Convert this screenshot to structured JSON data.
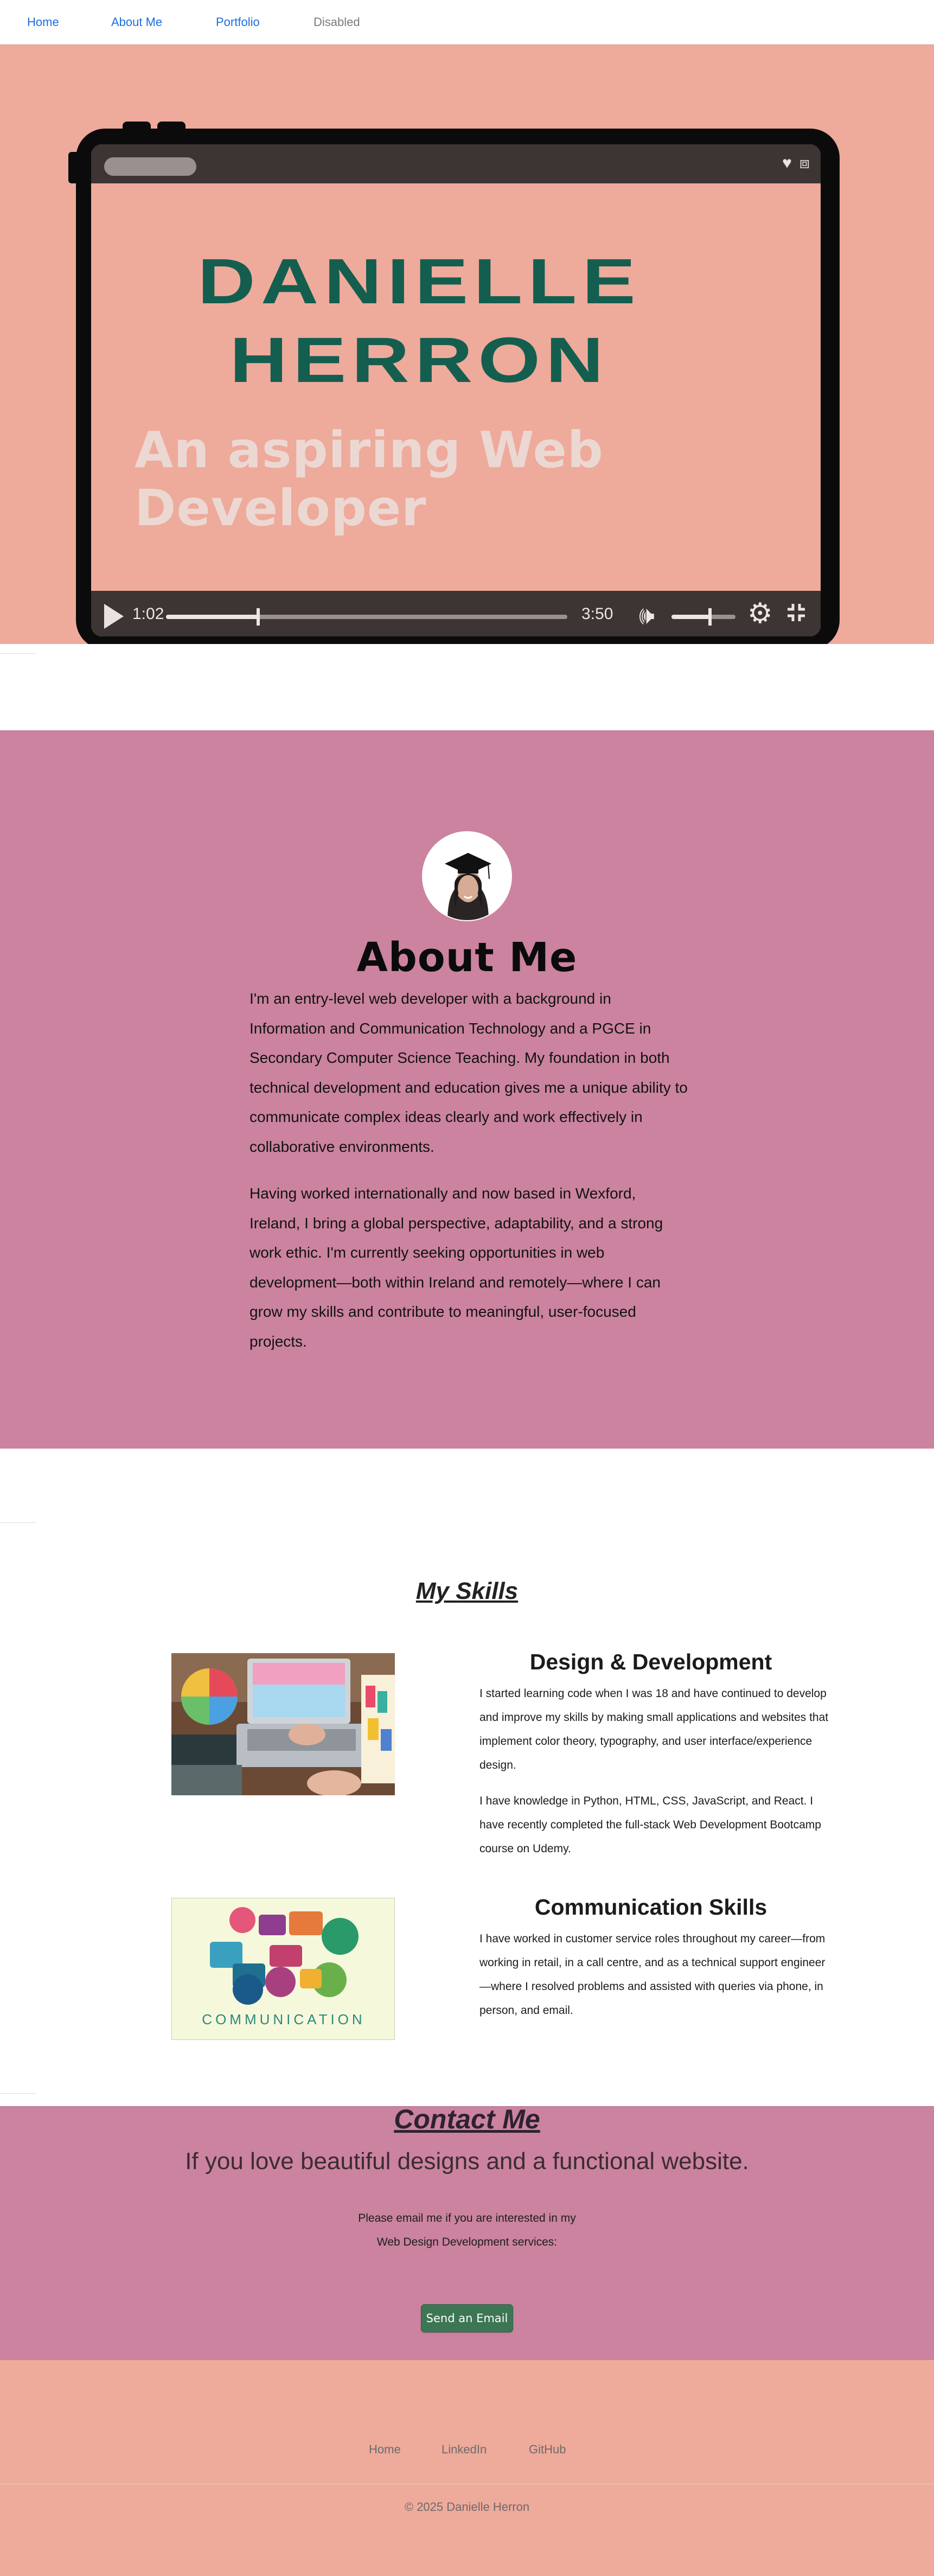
{
  "nav": {
    "items": [
      {
        "label": "Home"
      },
      {
        "label": "About Me"
      },
      {
        "label": "Portfolio"
      },
      {
        "label": "Disabled"
      }
    ]
  },
  "hero": {
    "name_line1": "DANIELLE",
    "name_line2": "HERRON",
    "tagline": "An aspiring Web Developer",
    "player": {
      "current_time": "1:02",
      "duration": "3:50",
      "progress": 0.23,
      "volume": 0.6,
      "icons": [
        "heart-icon",
        "share-icon",
        "play-icon",
        "volume-icon",
        "gear-icon",
        "fullscreen-exit-icon"
      ]
    },
    "background_color": "#eeaa9b",
    "name_color": "#145e4f"
  },
  "about": {
    "title": "About Me",
    "paragraph1": "I'm an entry-level web developer with a background in Information and Communication Technology and a PGCE in Secondary Computer Science Teaching. My foundation in both technical development and education gives me a unique ability to communicate complex ideas clearly and work effectively in collaborative environments.",
    "paragraph2": "Having worked internationally and now based in Wexford, Ireland, I bring a global perspective, adaptability, and a strong work ethic. I'm currently seeking opportunities in web development—both within Ireland and remotely—where I can grow my skills and contribute to meaningful, user-focused projects.",
    "background_color": "#cb839f"
  },
  "skills": {
    "title": "My Skills",
    "items": [
      {
        "heading": "Design & Development",
        "paragraph1": "I started learning code when I was 18 and have continued to develop and improve my skills by making small applications and websites that implement color theory, typography, and user interface/experience design.",
        "paragraph2": "I have knowledge in Python, HTML, CSS, JavaScript, and React. I have recently completed the full-stack Web Development Bootcamp course on Udemy."
      },
      {
        "heading": "Communication Skills",
        "paragraph1": "I have worked in customer service roles throughout my career—from working in retail, in a call centre, and as a technical support engineer—where I resolved problems and assisted with queries via phone, in person, and email.",
        "image_text": "COMMUNICATION"
      }
    ]
  },
  "contact": {
    "title": "Contact Me",
    "subtitle": "If you love beautiful designs and a functional website.",
    "line1": "Please email me if you are interested in my",
    "line2": "Web Design Development services:",
    "button_label": "Send an Email",
    "button_color": "#3d7655"
  },
  "footer": {
    "links": [
      {
        "label": "Home"
      },
      {
        "label": "LinkedIn"
      },
      {
        "label": "GitHub"
      }
    ],
    "copyright": "© 2025 Danielle Herron"
  }
}
